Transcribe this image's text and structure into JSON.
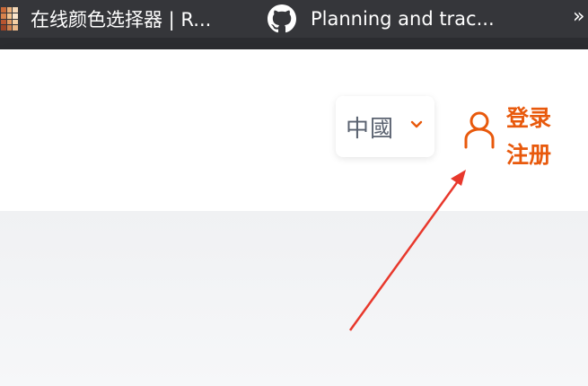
{
  "bookmarks_bar": {
    "items": [
      {
        "label": "在线颜色选择器 | R...",
        "icon": "color-grid-icon"
      },
      {
        "label": "Planning and trac...",
        "icon": "github-icon"
      }
    ],
    "overflow": "»"
  },
  "header": {
    "language": {
      "label": "中國",
      "icon": "chevron-down-icon"
    },
    "account": {
      "login_label": "登录",
      "register_label": "注册",
      "icon": "user-icon"
    }
  },
  "colors": {
    "accent": "#e8590c",
    "bookmarks_bg": "#35363a",
    "arrow": "#e8382c"
  }
}
